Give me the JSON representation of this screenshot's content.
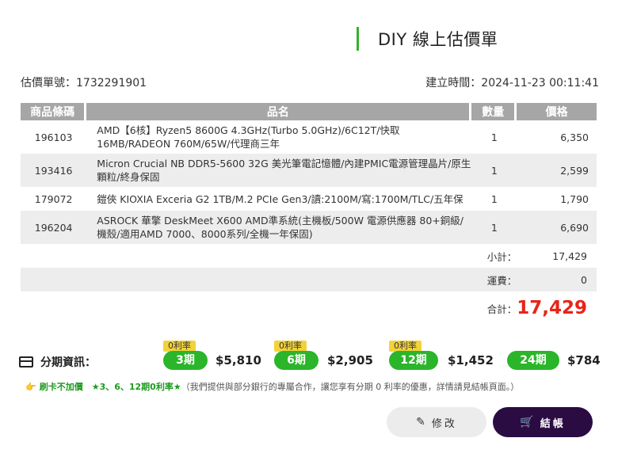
{
  "title": "DIY 線上估價單",
  "meta": {
    "quote_no": "估價單號：1732291901",
    "created": "建立時間：2024-11-23 00:11:41"
  },
  "table": {
    "headers": [
      "商品條碼",
      "品名",
      "數量",
      "價格"
    ],
    "rows": [
      {
        "code": "196103",
        "name": "AMD【6核】Ryzen5 8600G 4.3GHz(Turbo 5.0GHz)/6C12T/快取16MB/RADEON 760M/65W/代理商三年",
        "qty": "1",
        "price": "6,350"
      },
      {
        "code": "193416",
        "name": "Micron Crucial NB DDR5-5600 32G 美光筆電記憶體/內建PMIC電源管理晶片/原生顆粒/終身保固",
        "qty": "1",
        "price": "2,599"
      },
      {
        "code": "179072",
        "name": "鎧俠 KIOXIA Exceria G2 1TB/M.2 PCIe Gen3/讀:2100M/寫:1700M/TLC/五年保",
        "qty": "1",
        "price": "1,790"
      },
      {
        "code": "196204",
        "name": "ASROCK 華擎 DeskMeet X600 AMD準系統(主機板/500W 電源供應器 80+銅級/機殼/適用AMD 7000、8000系列/全機一年保固)",
        "qty": "1",
        "price": "6,690"
      }
    ]
  },
  "summary": {
    "subtotal_label": "小計：",
    "subtotal": "17,429",
    "shipping_label": "運費：",
    "shipping": "0",
    "total_label": "合計：",
    "total": "17,429"
  },
  "installments": {
    "label": "分期資訊：",
    "plans": [
      {
        "badge": "0利率",
        "term": "3期",
        "amount": "$5,810"
      },
      {
        "badge": "0利率",
        "term": "6期",
        "amount": "$2,905"
      },
      {
        "badge": "0利率",
        "term": "12期",
        "amount": "$1,452"
      },
      {
        "badge": "",
        "term": "24期",
        "amount": "$784"
      }
    ]
  },
  "note": {
    "lead": "刷卡不加價　★3、6、12期0利率★",
    "text": "（我們提供與部分銀行的專屬合作，讓您享有分期 0 利率的優惠，詳情請見結帳頁面。）"
  },
  "buttons": {
    "edit": "修改",
    "checkout": "結帳"
  },
  "colors": {
    "accent_green": "#2bb52a",
    "price_red": "#e82418",
    "checkout_bg": "#2a0c43",
    "header_gray": "#a6a6a6"
  }
}
